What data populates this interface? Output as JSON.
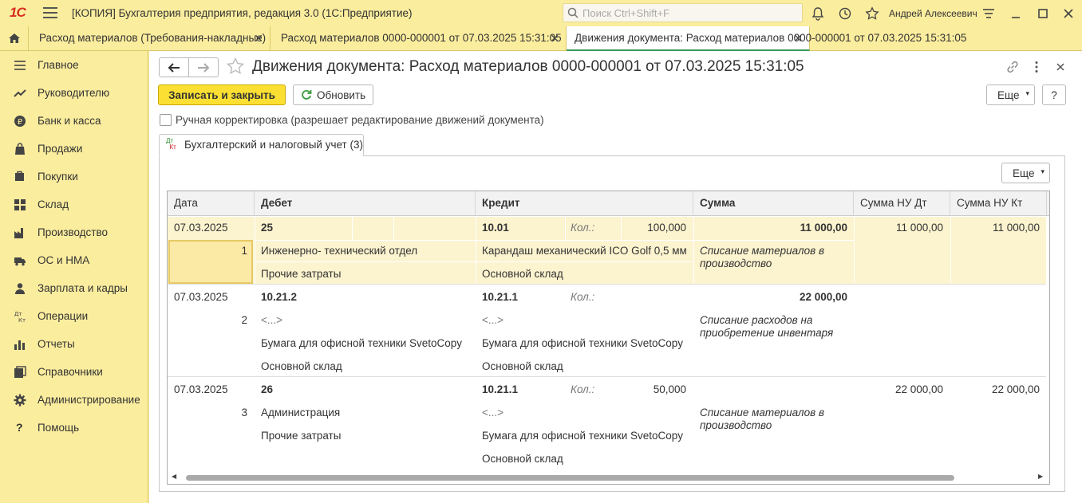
{
  "app": {
    "logo": "1С",
    "title": "[КОПИЯ] Бухгалтерия предприятия, редакция 3.0  (1С:Предприятие)",
    "search_placeholder": "Поиск Ctrl+Shift+F",
    "user": "Андрей Алексеевич"
  },
  "tabs": [
    {
      "label": "Расход материалов (Требования-накладные)"
    },
    {
      "label": "Расход материалов 0000-000001 от 07.03.2025 15:31:05"
    },
    {
      "label": "Движения документа: Расход материалов 0000-000001 от 07.03.2025 15:31:05"
    }
  ],
  "sidebar": {
    "items": [
      {
        "label": "Главное",
        "icon": "menu-lines-icon"
      },
      {
        "label": "Руководителю",
        "icon": "trend-icon"
      },
      {
        "label": "Банк и касса",
        "icon": "coin-icon"
      },
      {
        "label": "Продажи",
        "icon": "bag-icon"
      },
      {
        "label": "Покупки",
        "icon": "cart-icon"
      },
      {
        "label": "Склад",
        "icon": "grid-icon"
      },
      {
        "label": "Производство",
        "icon": "factory-icon"
      },
      {
        "label": "ОС и НМА",
        "icon": "truck-icon"
      },
      {
        "label": "Зарплата и кадры",
        "icon": "person-icon"
      },
      {
        "label": "Операции",
        "icon": "dt-kt-icon"
      },
      {
        "label": "Отчеты",
        "icon": "bar-chart-icon"
      },
      {
        "label": "Справочники",
        "icon": "books-icon"
      },
      {
        "label": "Администрирование",
        "icon": "gear-icon"
      },
      {
        "label": "Помощь",
        "icon": "question-icon"
      }
    ]
  },
  "form": {
    "title": "Движения документа: Расход материалов 0000-000001 от 07.03.2025 15:31:05",
    "save_label": "Записать и закрыть",
    "refresh_label": "Обновить",
    "more_label": "Еще",
    "help_label": "?",
    "manual_label": "Ручная корректировка (разрешает редактирование движений документа)",
    "manual_checked": false,
    "pane_tab_label": "Бухгалтерский и налоговый учет (3)",
    "dt_kt": [
      "Дт",
      "Кт"
    ]
  },
  "grid": {
    "headers": {
      "date": "Дата",
      "debit": "Дебет",
      "credit": "Кредит",
      "sum": "Сумма",
      "sum_nu_dt": "Сумма НУ Дт",
      "sum_nu_kt": "Сумма НУ Кт"
    },
    "qty_label": "Кол.:",
    "rows": [
      {
        "date": "07.03.2025",
        "num": "1",
        "debit_account": "25",
        "debit_lines": [
          "Инженерно- технический отдел",
          "Прочие затраты"
        ],
        "credit_account": "10.01",
        "qty": "100,000",
        "credit_lines": [
          "Карандаш механический ICO Golf 0,5 мм",
          "Основной склад"
        ],
        "sum": "11 000,00",
        "sum_desc_1": "Списание материалов в",
        "sum_desc_2": "производство",
        "nu_dt": "11 000,00",
        "nu_kt": "11 000,00"
      },
      {
        "date": "07.03.2025",
        "num": "2",
        "debit_account": "10.21.2",
        "debit_lines": [
          "<...>",
          "Бумага для офисной техники SvetoCopy",
          "Основной склад"
        ],
        "credit_account": "10.21.1",
        "qty": "",
        "credit_lines": [
          "<...>",
          "Бумага для офисной техники SvetoCopy",
          "Основной склад"
        ],
        "sum": "22 000,00",
        "sum_desc_1": "Списание расходов на",
        "sum_desc_2": "приобретение инвентаря",
        "nu_dt": "",
        "nu_kt": ""
      },
      {
        "date": "07.03.2025",
        "num": "3",
        "debit_account": "26",
        "debit_lines": [
          "Администрация",
          "Прочие затраты"
        ],
        "credit_account": "10.21.1",
        "qty": "50,000",
        "credit_lines": [
          "<...>",
          "Бумага для офисной техники SvetoCopy",
          "Основной склад"
        ],
        "sum": "",
        "sum_desc_1": "Списание материалов в",
        "sum_desc_2": "производство",
        "nu_dt": "22 000,00",
        "nu_kt": "22 000,00"
      }
    ]
  }
}
